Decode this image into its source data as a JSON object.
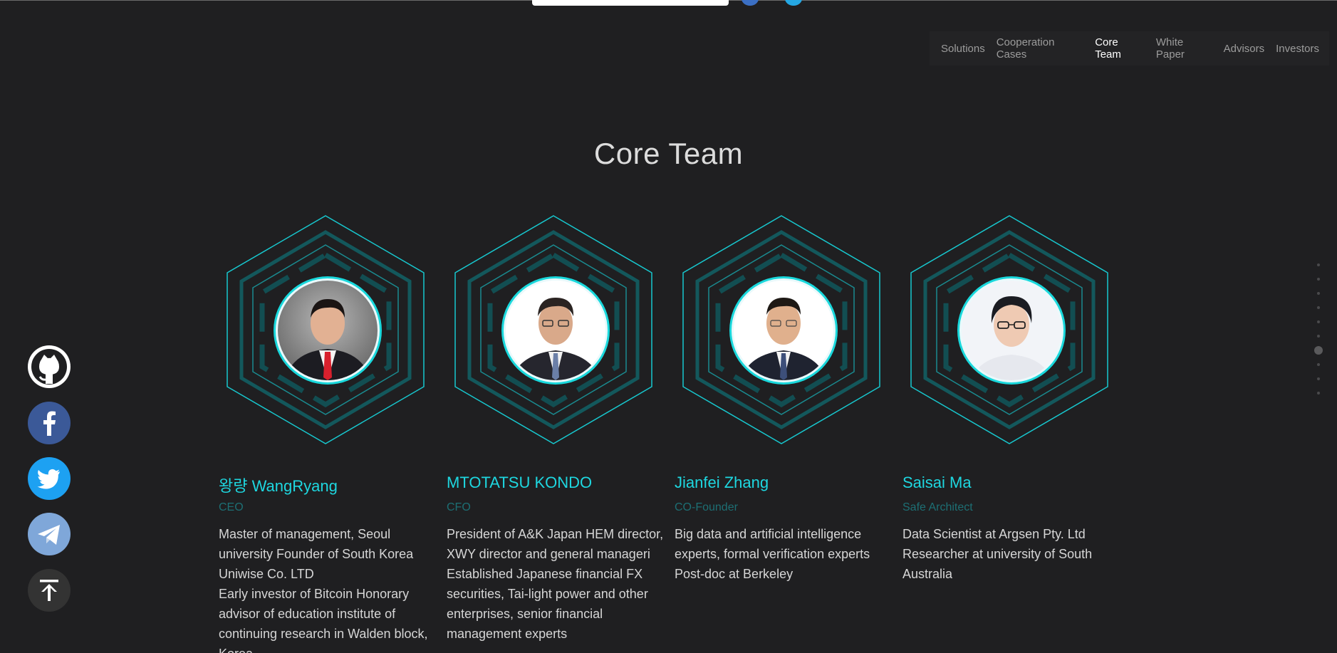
{
  "nav": {
    "items": [
      "Solutions",
      "Cooperation Cases",
      "Core Team",
      "White Paper",
      "Advisors",
      "Investors"
    ],
    "active": "Core Team"
  },
  "section": {
    "title": "Core Team"
  },
  "team": [
    {
      "name": "왕량 WangRyang",
      "role": "CEO",
      "bio": [
        "Master of management, Seoul university Founder of South Korea Uniwise Co. LTD",
        "Early investor of Bitcoin Honorary advisor of education institute of continuing research in Walden block, Korea"
      ]
    },
    {
      "name": "MTOTATSU KONDO",
      "role": "CFO",
      "bio": [
        "President of A&K Japan HEM director, XWY director and general manageri",
        "Established Japanese financial FX securities, Tai-light power and other enterprises, senior financial management experts"
      ]
    },
    {
      "name": "Jianfei Zhang",
      "role": "CO-Founder",
      "bio": [
        "Big data and artificial intelligence experts, formal verification experts Post-doc at Berkeley"
      ]
    },
    {
      "name": "Saisai Ma",
      "role": "Safe Architect",
      "bio": [
        "Data Scientist at Argsen Pty. Ltd Researcher at university of South Australia"
      ]
    }
  ],
  "social": [
    {
      "icon": "github-icon",
      "color": "#ffffff"
    },
    {
      "icon": "facebook-icon",
      "color": "#3b5998"
    },
    {
      "icon": "twitter-icon",
      "color": "#1da1f2"
    },
    {
      "icon": "telegram-icon",
      "color": "#7fa7d9"
    },
    {
      "icon": "back-to-top-icon",
      "color": "#333333"
    }
  ],
  "colors": {
    "background": "#1f1f21",
    "accent": "#1ed7e0",
    "role": "#1d6f74"
  },
  "dot_nav": {
    "count": 10,
    "active_index": 6
  }
}
